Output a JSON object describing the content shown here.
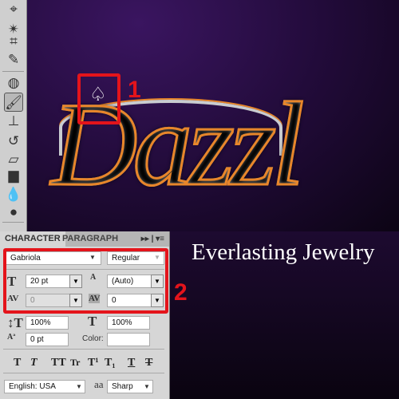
{
  "canvas": {
    "art_text": "Dazzl",
    "tagline": "Everlasting Jewelry"
  },
  "annotations": {
    "marker1": "1",
    "marker2": "2",
    "color": "#e4141b"
  },
  "toolbar": {
    "tools": [
      "lasso-icon",
      "magic-wand-icon",
      "crop-icon",
      "eyedropper-icon",
      "healing-brush-icon",
      "brush-icon",
      "clone-stamp-icon",
      "history-brush-icon",
      "eraser-icon",
      "gradient-icon",
      "blur-icon",
      "dodge-icon"
    ],
    "active": "brush-icon"
  },
  "panel": {
    "tabs": [
      "CHARACTER",
      "PARAGRAPH"
    ],
    "menu_glyph": "▸▸ | ▾≡",
    "font_family": "Gabriola",
    "font_style": "Regular",
    "font_size": "20 pt",
    "leading": "(Auto)",
    "kerning": "0",
    "tracking": "0",
    "vertical_scale": "100%",
    "horizontal_scale": "100%",
    "baseline_shift": "0 pt",
    "color_label": "Color:",
    "style_buttons": [
      "T",
      "T",
      "TT",
      "Tr",
      "T¹",
      "T₁",
      "T",
      "T"
    ],
    "language": "English: USA",
    "antialias_icon": "aa",
    "antialias": "Sharp"
  }
}
